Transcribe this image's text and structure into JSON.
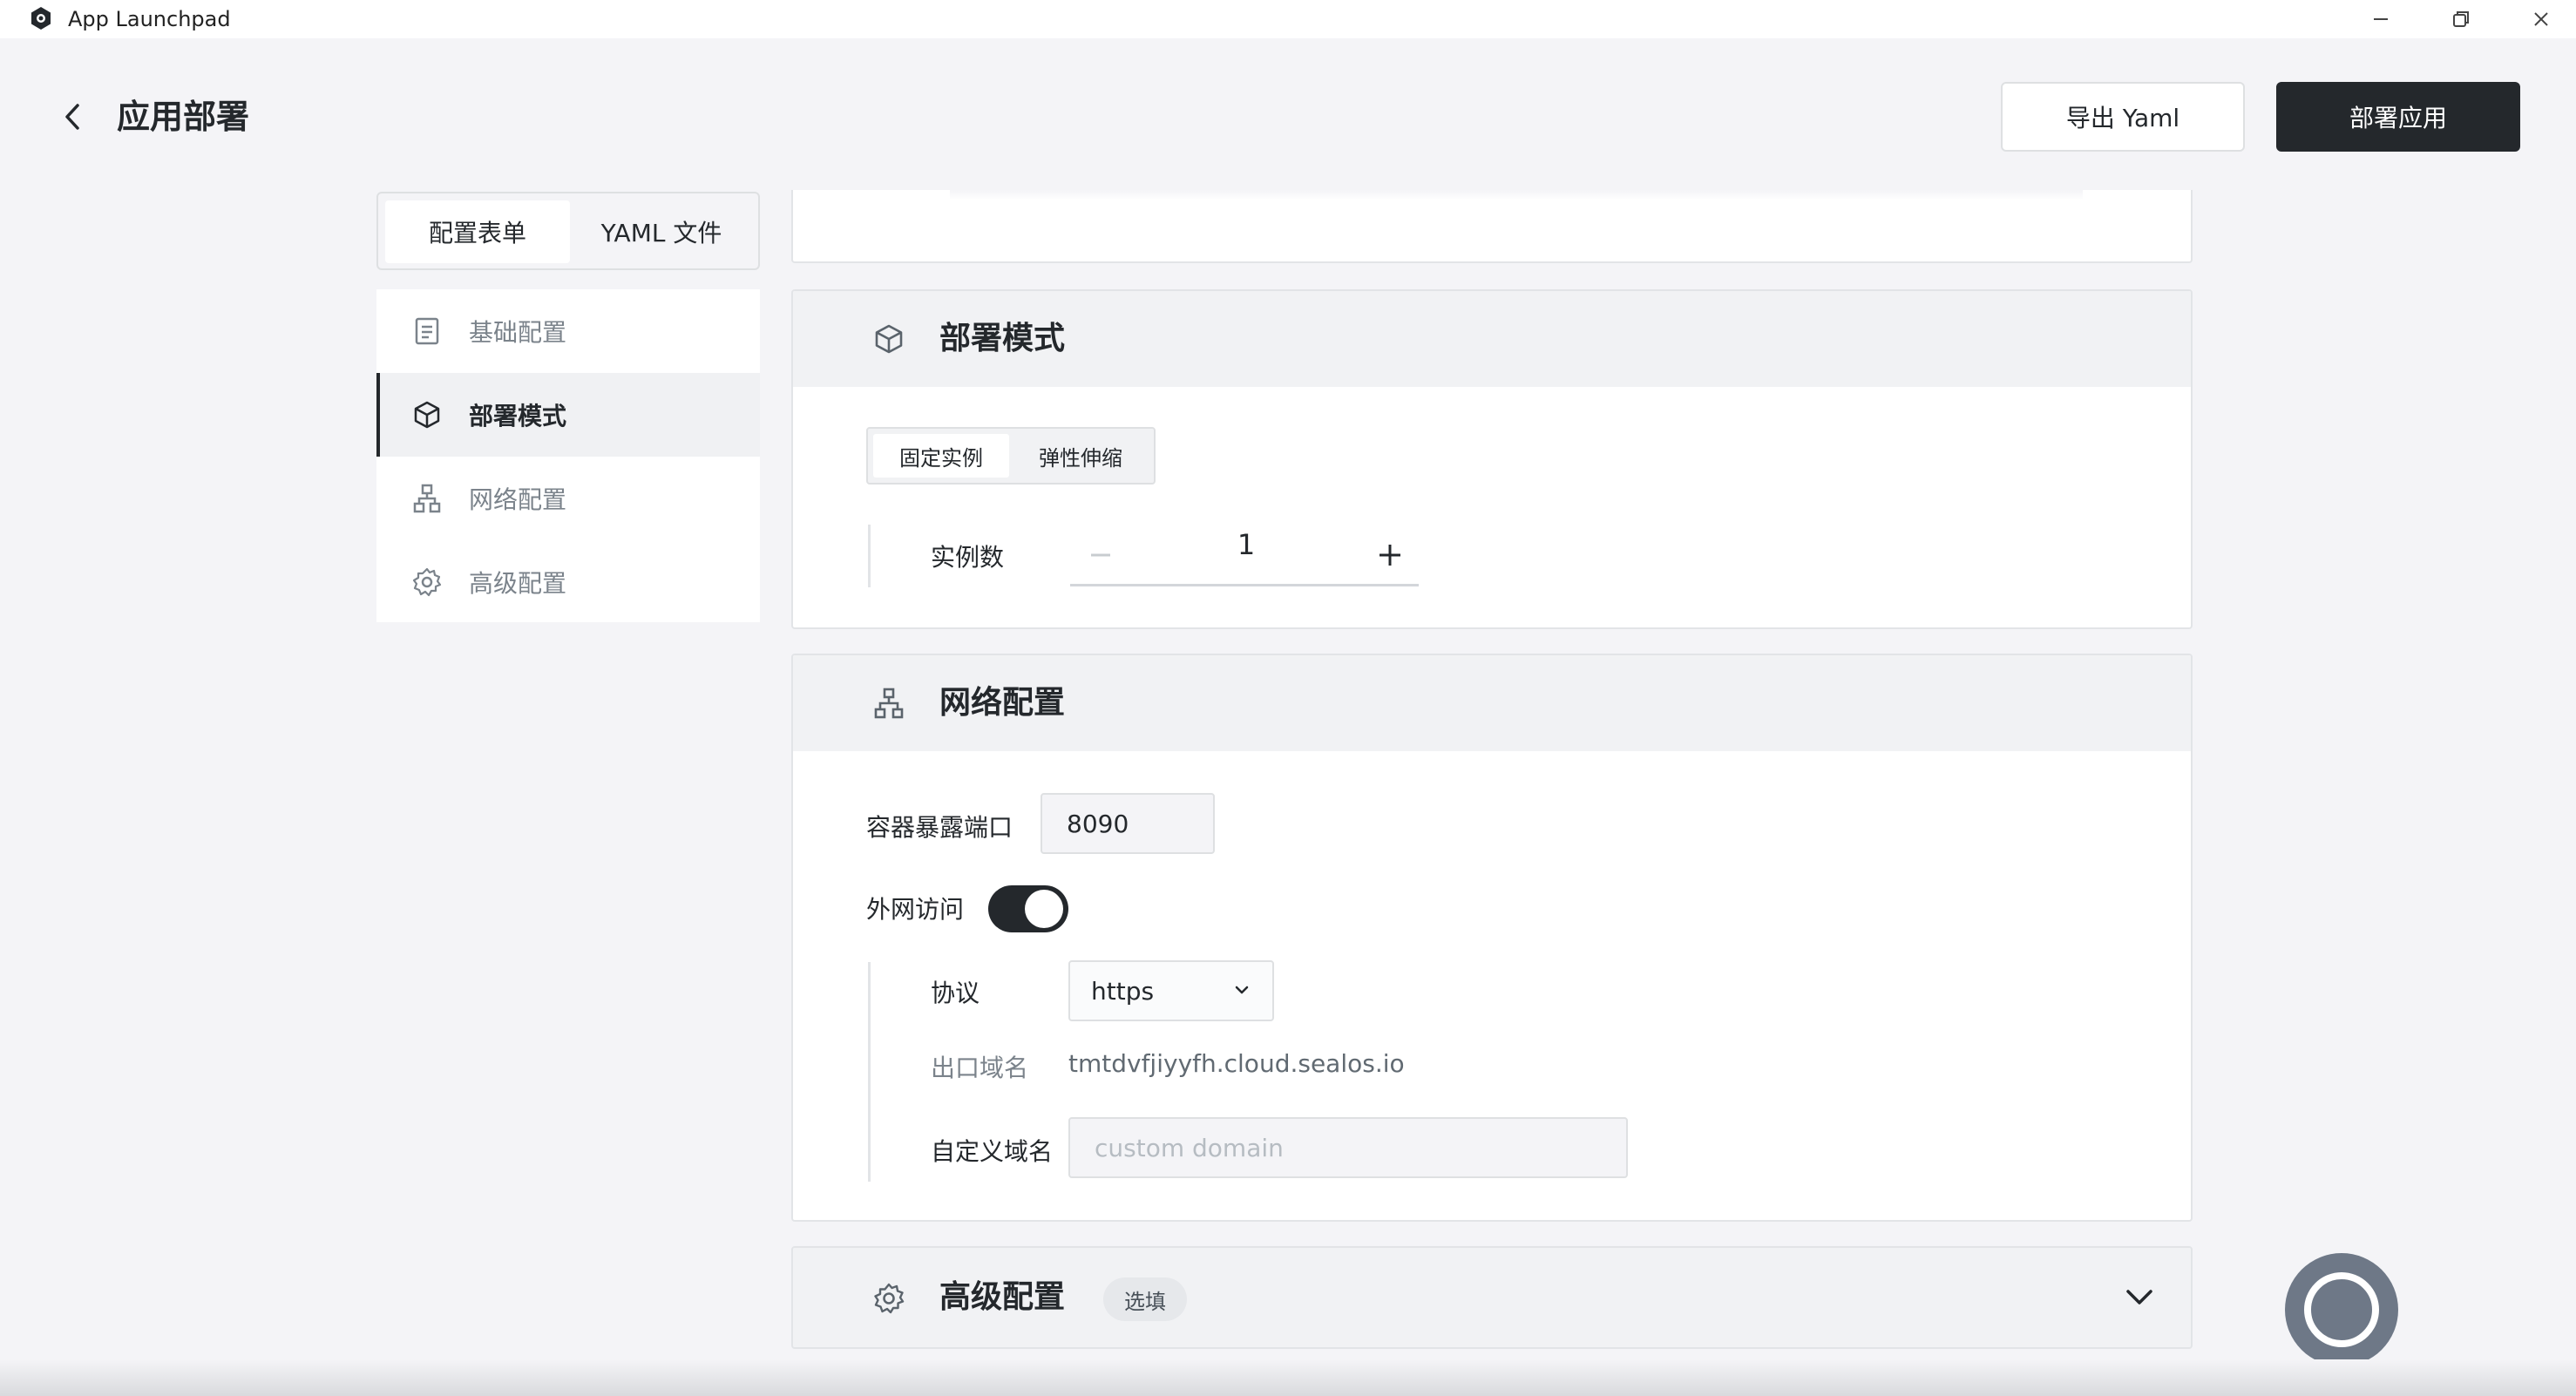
{
  "window": {
    "title": "App Launchpad",
    "controls": [
      "minimize",
      "restore",
      "close"
    ]
  },
  "header": {
    "title": "应用部署",
    "export_label": "导出 Yaml",
    "deploy_label": "部署应用"
  },
  "tabs": [
    {
      "label": "配置表单",
      "active": true
    },
    {
      "label": "YAML 文件",
      "active": false
    }
  ],
  "nav": {
    "items": [
      {
        "label": "基础配置",
        "icon": "document-list-icon",
        "active": false
      },
      {
        "label": "部署模式",
        "icon": "cube-icon",
        "active": true
      },
      {
        "label": "网络配置",
        "icon": "network-icon",
        "active": false
      },
      {
        "label": "高级配置",
        "icon": "gear-icon",
        "active": false
      }
    ]
  },
  "deploy_mode": {
    "title": "部署模式",
    "modes": [
      "固定实例",
      "弹性伸缩"
    ],
    "selected_mode": "固定实例",
    "instance_label": "实例数",
    "instance_count": "1"
  },
  "network": {
    "title": "网络配置",
    "port_label": "容器暴露端口",
    "port_value": "8090",
    "public_label": "外网访问",
    "public_enabled": true,
    "protocol_label": "协议",
    "protocol_value": "https",
    "domain_label": "出口域名",
    "domain_value": "tmtdvfjiyyfh.cloud.sealos.io",
    "custom_domain_label": "自定义域名",
    "custom_domain_placeholder": "custom domain"
  },
  "advanced": {
    "title": "高级配置",
    "badge": "选填",
    "expanded": false
  },
  "colors": {
    "primary": "#24282c",
    "background": "#f4f4f7",
    "card_header": "#f1f2f4",
    "border": "#e2e4e7",
    "fab": "#6e7887"
  }
}
